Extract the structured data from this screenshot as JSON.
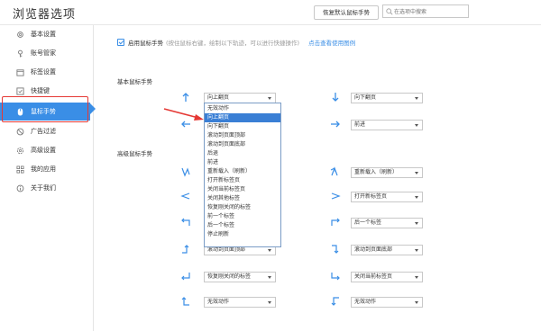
{
  "header": {
    "title": "浏览器选项",
    "restore_label": "恢复默认鼠标手势",
    "search_placeholder": "在选项中搜索"
  },
  "sidebar": {
    "items": [
      {
        "label": "基本设置",
        "icon": "gear-icon"
      },
      {
        "label": "账号管家",
        "icon": "key-icon"
      },
      {
        "label": "标签设置",
        "icon": "tab-icon"
      },
      {
        "label": "快捷键",
        "icon": "keyboard-icon"
      },
      {
        "label": "鼠标手势",
        "icon": "mouse-icon",
        "active": true
      },
      {
        "label": "广告过滤",
        "icon": "block-icon"
      },
      {
        "label": "高级设置",
        "icon": "advanced-gear-icon"
      },
      {
        "label": "我的应用",
        "icon": "apps-icon"
      },
      {
        "label": "关于我们",
        "icon": "info-icon"
      }
    ]
  },
  "main": {
    "enable": {
      "checked": true,
      "label": "启用鼠标手势",
      "hint": "(按住鼠标右键，绘制以下轨迹，可以进行快捷操作)",
      "link": "点击查看使用图例"
    },
    "basic_title": "基本鼠标手势",
    "advanced_title": "高级鼠标手势",
    "basic_gestures": [
      {
        "icon": "arrow-up-icon",
        "value": "向上翻页"
      },
      {
        "icon": "arrow-down-icon",
        "value": "向下翻页"
      },
      {
        "icon": "arrow-left-icon",
        "value": ""
      },
      {
        "icon": "arrow-right-icon",
        "value": "前进"
      }
    ],
    "advanced_gestures": [
      {
        "icon": "gesture-down-up-icon",
        "value": ""
      },
      {
        "icon": "gesture-up-down-icon",
        "value": "重新载入（刷新）"
      },
      {
        "icon": "gesture-right-left-icon",
        "value": ""
      },
      {
        "icon": "gesture-left-right-icon",
        "value": "打开新标签页"
      },
      {
        "icon": "gesture-up-left-icon",
        "value": ""
      },
      {
        "icon": "gesture-up-right-icon",
        "value": "后一个标签"
      },
      {
        "icon": "gesture-right-up-icon",
        "value": "滚动到页面顶部"
      },
      {
        "icon": "gesture-right-down-icon",
        "value": "滚动到页面底部"
      },
      {
        "icon": "gesture-down-left-icon",
        "value": "恢复刚关闭的标签"
      },
      {
        "icon": "gesture-down-right-icon",
        "value": "关闭当前标签页"
      },
      {
        "icon": "gesture-left-up-icon",
        "value": "无效动作"
      },
      {
        "icon": "gesture-left-down-icon",
        "value": "无效动作"
      }
    ],
    "dropdown_options": [
      "无效动作",
      "向上翻页",
      "向下翻页",
      "滚动到页面顶部",
      "滚动到页面底部",
      "后退",
      "前进",
      "重新载入（刷新）",
      "打开新标签页",
      "关闭当前标签页",
      "关闭其他标签",
      "恢复刚关闭的标签",
      "前一个标签",
      "后一个标签",
      "停止刷新"
    ],
    "dropdown_selected_index": 1
  },
  "colors": {
    "accent": "#3a8ee6",
    "highlight": "#e53935"
  }
}
